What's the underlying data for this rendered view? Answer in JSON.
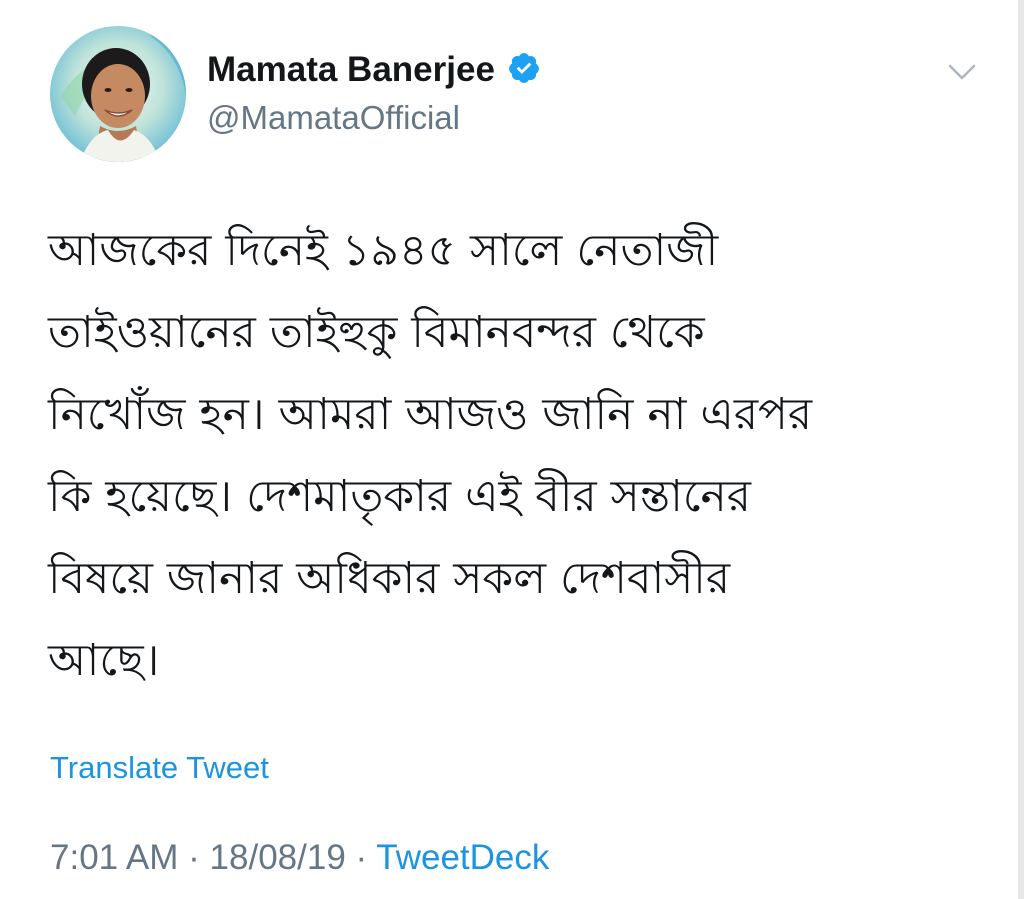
{
  "author": {
    "display_name": "Mamata Banerjee",
    "handle": "@MamataOfficial",
    "verified": true,
    "avatar_icon": "profile-photo"
  },
  "icons": {
    "verified": "verified-badge-icon",
    "menu": "chevron-down-icon"
  },
  "tweet": {
    "text_lines": [
      "আজকের দিনেই ১৯৪৫ সালে নেতাজী",
      "তাইওয়ানের তাইহুকু বিমানবন্দর থেকে",
      "নিখোঁজ হন। আমরা আজও জানি না এরপর",
      "কি হয়েছে। দেশমাতৃকার এই বীর সন্তানের",
      "বিষয়ে জানার অধিকার সকল দেশবাসীর",
      "আছে।"
    ],
    "translate_label": "Translate Tweet"
  },
  "meta": {
    "time": "7:01 AM",
    "separator": "·",
    "date": "18/08/19",
    "source": "TweetDeck"
  },
  "colors": {
    "link": "#1b95e0",
    "secondary_text": "#657786",
    "primary_text": "#14171a",
    "verified_badge": "#1da1f2"
  }
}
